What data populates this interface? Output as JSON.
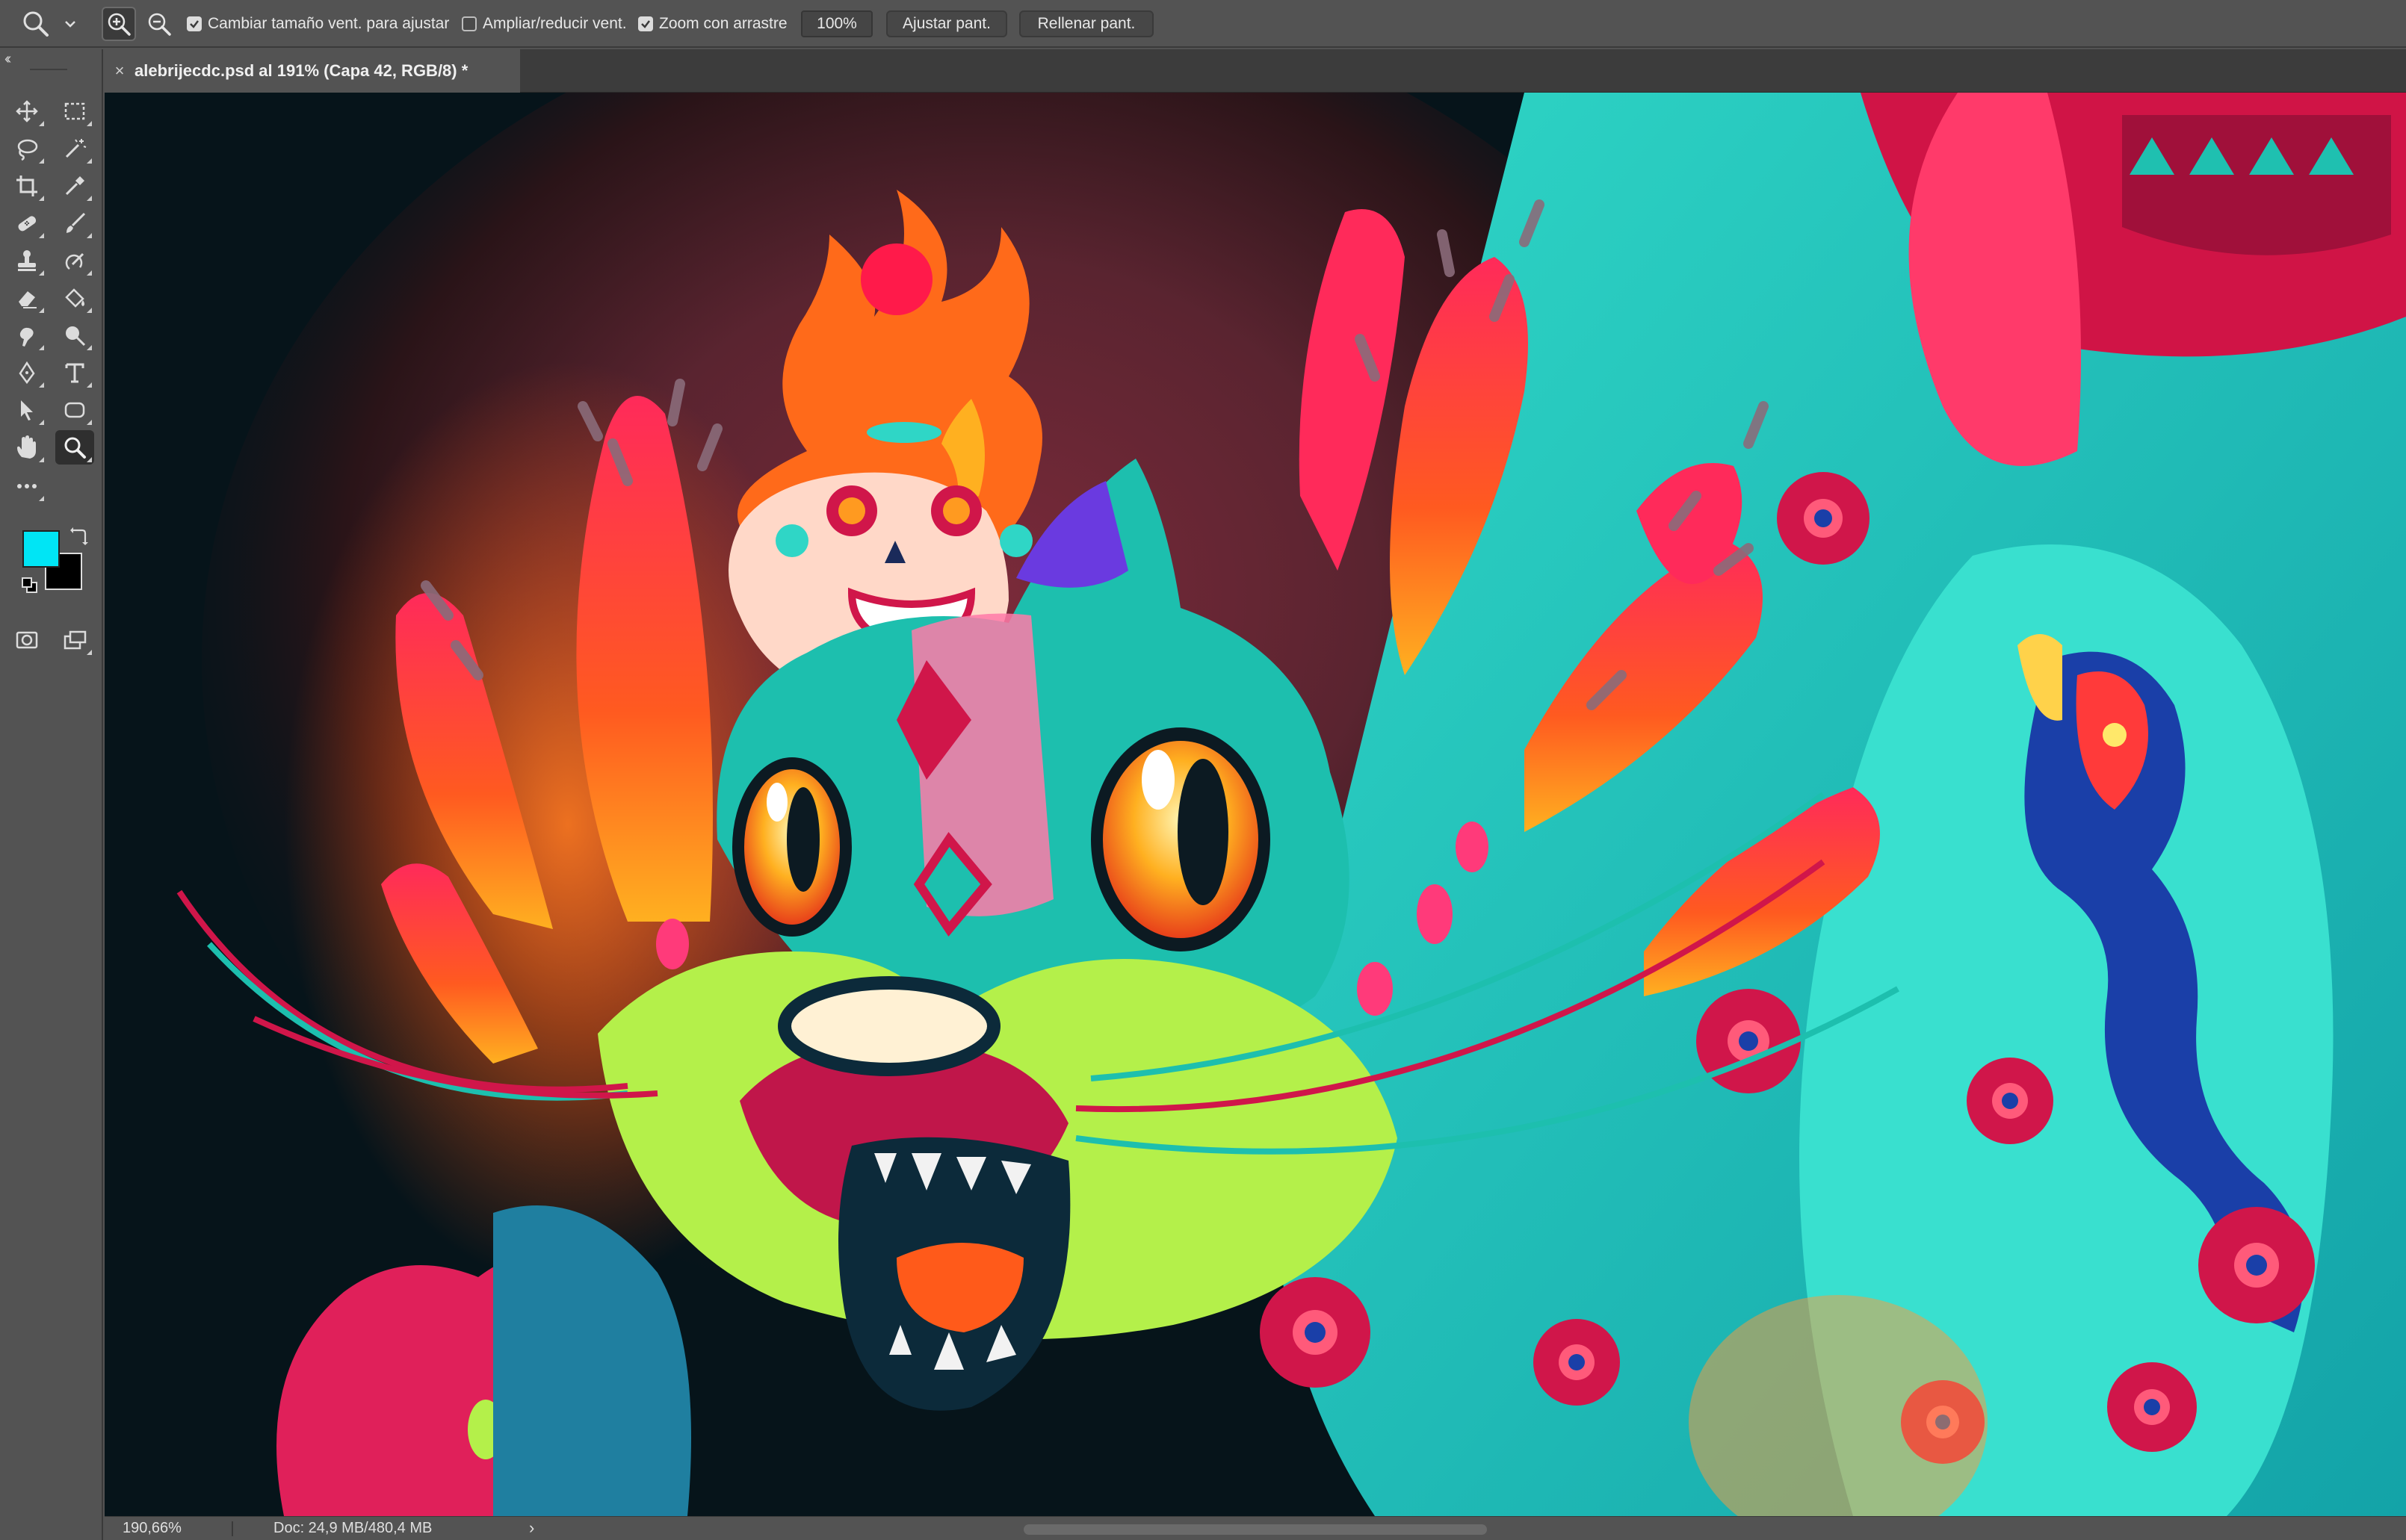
{
  "options_bar": {
    "zoom_in_tooltip": "zoom-in",
    "zoom_out_tooltip": "zoom-out",
    "resize_windows_label": "Cambiar tamaño vent. para ajustar",
    "resize_windows_checked": true,
    "zoom_all_windows_label": "Ampliar/reducir vent.",
    "zoom_all_windows_checked": false,
    "scrubby_zoom_label": "Zoom con arrastre",
    "scrubby_zoom_checked": true,
    "zoom_value": "100%",
    "fit_screen_label": "Ajustar pant.",
    "fill_screen_label": "Rellenar pant."
  },
  "toolbar": {
    "collapse_label": "‹‹",
    "foreground_color": "#00e5f5",
    "background_color": "#000000",
    "tools": [
      "move",
      "marquee",
      "lasso",
      "magic-wand",
      "crop",
      "eyedropper",
      "healing",
      "brush",
      "stamp",
      "history-brush",
      "eraser",
      "paint-bucket",
      "smudge",
      "dodge",
      "pen",
      "type",
      "path-select",
      "rectangle",
      "hand",
      "zoom",
      "more"
    ]
  },
  "document": {
    "tab_title": "alebrijecdc.psd al 191% (Capa 42, RGB/8) *",
    "close_symbol": "×"
  },
  "status": {
    "zoom": "190,66%",
    "doc_info": "Doc: 24,9 MB/480,4 MB",
    "arrow": "›"
  }
}
